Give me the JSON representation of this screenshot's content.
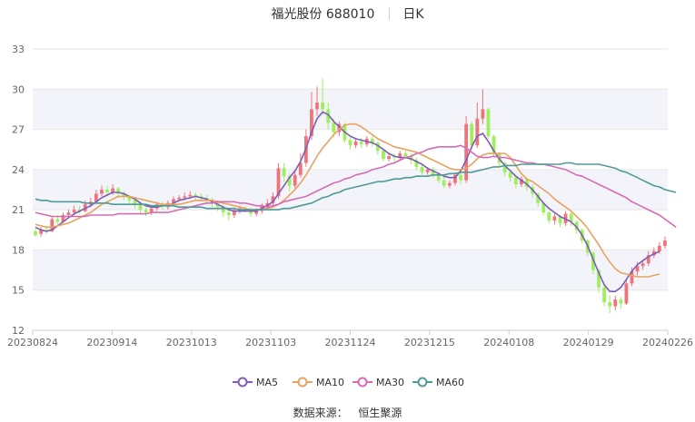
{
  "header": {
    "stock": "福光股份 688010",
    "period": "日K"
  },
  "source": {
    "label": "数据来源：",
    "value": "恒生聚源"
  },
  "colors": {
    "up": "#f0737a",
    "down": "#9cf05c",
    "ma5": "#7e5cb7",
    "ma10": "#e8a261",
    "ma30": "#d86bb4",
    "ma60": "#4f9a98"
  },
  "chart_data": {
    "type": "candlestick",
    "title": "福光股份 688010 日K",
    "ylim": [
      12,
      33
    ],
    "yticks": [
      12,
      15,
      18,
      21,
      24,
      27,
      30,
      33
    ],
    "xticks": [
      "20230824",
      "20230914",
      "20231013",
      "20231103",
      "20231124",
      "20231215",
      "20240108",
      "20240129",
      "20240226"
    ],
    "grid": "horizontal",
    "legend_position": "bottom",
    "legend": [
      "MA5",
      "MA10",
      "MA30",
      "MA60"
    ],
    "candles": [
      [
        19.4,
        19.1,
        19.6,
        19.0
      ],
      [
        19.2,
        19.5,
        19.7,
        19.0
      ],
      [
        19.5,
        19.4,
        19.8,
        19.2
      ],
      [
        19.4,
        20.3,
        20.5,
        19.3
      ],
      [
        20.3,
        20.1,
        20.6,
        19.9
      ],
      [
        20.1,
        20.6,
        20.8,
        20.0
      ],
      [
        20.6,
        20.8,
        21.0,
        20.4
      ],
      [
        20.8,
        21.0,
        21.3,
        20.6
      ],
      [
        21.0,
        20.9,
        21.3,
        20.7
      ],
      [
        20.9,
        21.4,
        21.7,
        20.8
      ],
      [
        21.4,
        21.6,
        21.9,
        21.2
      ],
      [
        21.6,
        22.2,
        22.5,
        21.4
      ],
      [
        22.2,
        22.5,
        22.8,
        22.0
      ],
      [
        22.5,
        22.3,
        22.8,
        22.0
      ],
      [
        22.3,
        22.6,
        22.9,
        22.1
      ],
      [
        22.6,
        22.2,
        22.7,
        21.9
      ],
      [
        22.2,
        22.0,
        22.4,
        21.7
      ],
      [
        22.0,
        21.7,
        22.1,
        21.4
      ],
      [
        21.7,
        21.4,
        21.9,
        21.1
      ],
      [
        21.4,
        21.0,
        21.6,
        20.7
      ],
      [
        21.0,
        20.8,
        21.2,
        20.5
      ],
      [
        20.8,
        21.1,
        21.3,
        20.6
      ],
      [
        21.1,
        21.4,
        21.6,
        20.9
      ],
      [
        21.4,
        21.2,
        21.6,
        21.0
      ],
      [
        21.2,
        21.5,
        21.7,
        21.0
      ],
      [
        21.5,
        21.8,
        22.0,
        21.3
      ],
      [
        21.8,
        21.9,
        22.1,
        21.6
      ],
      [
        21.9,
        22.0,
        22.3,
        21.7
      ],
      [
        22.0,
        22.1,
        22.4,
        21.8
      ],
      [
        22.1,
        22.0,
        22.3,
        21.7
      ],
      [
        22.0,
        21.9,
        22.2,
        21.6
      ],
      [
        21.9,
        21.7,
        22.1,
        21.5
      ],
      [
        21.7,
        21.5,
        21.9,
        21.2
      ],
      [
        21.5,
        21.2,
        21.7,
        20.9
      ],
      [
        21.2,
        20.8,
        21.4,
        20.5
      ],
      [
        20.8,
        20.6,
        21.0,
        20.2
      ],
      [
        20.6,
        20.9,
        21.1,
        20.4
      ],
      [
        20.9,
        21.1,
        21.3,
        20.7
      ],
      [
        21.1,
        21.0,
        21.3,
        20.8
      ],
      [
        21.0,
        20.7,
        21.2,
        20.5
      ],
      [
        20.7,
        20.9,
        21.1,
        20.5
      ],
      [
        20.9,
        21.3,
        21.5,
        20.7
      ],
      [
        21.3,
        21.5,
        21.8,
        21.1
      ],
      [
        21.5,
        22.0,
        22.3,
        21.3
      ],
      [
        22.0,
        24.1,
        24.5,
        21.8
      ],
      [
        24.1,
        23.5,
        24.5,
        23.1
      ],
      [
        23.5,
        22.8,
        23.7,
        22.4
      ],
      [
        22.8,
        23.6,
        24.0,
        22.6
      ],
      [
        23.6,
        24.5,
        25.2,
        23.4
      ],
      [
        24.5,
        26.5,
        27.0,
        24.2
      ],
      [
        26.5,
        28.5,
        29.8,
        26.2
      ],
      [
        28.5,
        29.0,
        30.2,
        28.0
      ],
      [
        29.0,
        28.5,
        30.8,
        28.1
      ],
      [
        28.5,
        27.5,
        29.0,
        27.0
      ],
      [
        27.5,
        26.8,
        27.8,
        26.4
      ],
      [
        26.8,
        27.4,
        27.6,
        26.5
      ],
      [
        27.4,
        26.2,
        27.5,
        26.0
      ],
      [
        26.2,
        25.8,
        26.4,
        25.5
      ],
      [
        25.8,
        26.1,
        26.3,
        25.6
      ],
      [
        26.1,
        25.9,
        26.4,
        25.6
      ],
      [
        25.9,
        26.3,
        26.5,
        25.7
      ],
      [
        26.3,
        26.0,
        26.5,
        25.7
      ],
      [
        26.0,
        25.4,
        26.1,
        25.1
      ],
      [
        25.4,
        24.8,
        25.6,
        24.6
      ],
      [
        24.8,
        25.0,
        25.2,
        24.6
      ],
      [
        25.0,
        24.9,
        25.2,
        24.6
      ],
      [
        24.9,
        25.2,
        25.4,
        24.7
      ],
      [
        25.2,
        25.0,
        25.4,
        24.8
      ],
      [
        25.0,
        24.7,
        25.2,
        24.4
      ],
      [
        24.7,
        24.2,
        24.9,
        24.0
      ],
      [
        24.2,
        23.8,
        24.4,
        23.6
      ],
      [
        23.8,
        24.0,
        24.2,
        23.6
      ],
      [
        24.0,
        23.6,
        24.2,
        23.4
      ],
      [
        23.6,
        23.2,
        23.8,
        23.0
      ],
      [
        23.2,
        22.8,
        23.5,
        22.6
      ],
      [
        22.8,
        23.0,
        23.2,
        22.6
      ],
      [
        23.0,
        23.6,
        23.8,
        22.8
      ],
      [
        23.6,
        23.2,
        23.8,
        22.9
      ],
      [
        23.2,
        27.4,
        28.0,
        23.0
      ],
      [
        27.4,
        25.8,
        27.6,
        25.5
      ],
      [
        25.8,
        27.8,
        29.0,
        25.6
      ],
      [
        27.8,
        28.5,
        30.0,
        27.4
      ],
      [
        28.5,
        26.5,
        28.6,
        26.3
      ],
      [
        26.5,
        25.2,
        26.6,
        25.0
      ],
      [
        25.2,
        24.5,
        25.3,
        24.2
      ],
      [
        24.5,
        23.8,
        24.6,
        23.5
      ],
      [
        23.8,
        23.4,
        24.0,
        23.1
      ],
      [
        23.4,
        22.9,
        23.6,
        22.6
      ],
      [
        22.9,
        23.3,
        23.5,
        22.7
      ],
      [
        23.3,
        22.7,
        23.4,
        22.4
      ],
      [
        22.7,
        22.2,
        22.9,
        21.9
      ],
      [
        22.2,
        21.5,
        22.3,
        21.2
      ],
      [
        21.5,
        20.8,
        21.6,
        20.6
      ],
      [
        20.8,
        20.2,
        20.9,
        20.0
      ],
      [
        20.2,
        20.5,
        20.7,
        19.9
      ],
      [
        20.5,
        20.0,
        20.6,
        19.7
      ],
      [
        20.0,
        20.7,
        20.9,
        19.8
      ],
      [
        20.7,
        20.1,
        20.8,
        19.8
      ],
      [
        20.1,
        19.5,
        20.2,
        19.2
      ],
      [
        19.5,
        18.7,
        19.6,
        18.5
      ],
      [
        18.7,
        17.8,
        18.8,
        17.5
      ],
      [
        17.8,
        16.5,
        17.9,
        16.2
      ],
      [
        16.5,
        15.2,
        16.6,
        14.8
      ],
      [
        15.2,
        14.1,
        15.3,
        13.8
      ],
      [
        14.1,
        13.8,
        14.6,
        13.3
      ],
      [
        13.8,
        14.3,
        14.6,
        13.5
      ],
      [
        14.3,
        14.0,
        14.5,
        13.6
      ],
      [
        14.0,
        15.5,
        15.8,
        13.9
      ],
      [
        15.5,
        16.4,
        16.7,
        15.3
      ],
      [
        16.4,
        16.8,
        17.1,
        16.1
      ],
      [
        16.8,
        17.0,
        17.3,
        16.5
      ],
      [
        17.0,
        17.6,
        17.9,
        16.8
      ],
      [
        17.6,
        17.9,
        18.2,
        17.4
      ],
      [
        17.9,
        18.3,
        18.6,
        17.7
      ],
      [
        18.3,
        18.7,
        19.0,
        18.1
      ]
    ],
    "series": [
      {
        "name": "MA5",
        "values": [
          19.7,
          19.5,
          19.4,
          19.5,
          19.8,
          20.1,
          20.4,
          20.7,
          20.9,
          21.1,
          21.3,
          21.6,
          21.9,
          22.1,
          22.3,
          22.3,
          22.2,
          22.0,
          21.8,
          21.5,
          21.3,
          21.2,
          21.2,
          21.3,
          21.3,
          21.5,
          21.7,
          21.8,
          21.9,
          22.0,
          21.9,
          21.8,
          21.6,
          21.4,
          21.2,
          21.0,
          20.9,
          20.9,
          20.9,
          20.9,
          20.9,
          21.1,
          21.3,
          21.6,
          22.2,
          22.8,
          23.4,
          23.9,
          24.6,
          25.6,
          26.8,
          27.8,
          28.3,
          28.1,
          27.6,
          27.2,
          26.8,
          26.5,
          26.3,
          26.2,
          26.1,
          26.0,
          25.8,
          25.5,
          25.2,
          25.0,
          24.9,
          24.9,
          24.8,
          24.6,
          24.4,
          24.1,
          23.9,
          23.7,
          23.5,
          23.4,
          23.4,
          23.9,
          24.7,
          25.7,
          26.5,
          26.7,
          26.1,
          25.4,
          24.8,
          24.3,
          23.9,
          23.5,
          23.2,
          22.9,
          22.5,
          22.0,
          21.5,
          21.1,
          20.8,
          20.5,
          20.3,
          20.1,
          19.7,
          19.1,
          18.3,
          17.3,
          16.3,
          15.4,
          14.9,
          14.9,
          15.2,
          15.8,
          16.4,
          16.9,
          17.2,
          17.5,
          17.7,
          17.9
        ]
      },
      {
        "name": "MA10",
        "values": [
          19.9,
          19.8,
          19.7,
          19.7,
          19.8,
          19.9,
          20.0,
          20.2,
          20.4,
          20.6,
          20.8,
          21.1,
          21.4,
          21.6,
          21.8,
          22.0,
          22.0,
          22.0,
          21.9,
          21.8,
          21.7,
          21.6,
          21.5,
          21.4,
          21.4,
          21.4,
          21.4,
          21.5,
          21.6,
          21.7,
          21.7,
          21.7,
          21.7,
          21.6,
          21.5,
          21.4,
          21.3,
          21.2,
          21.1,
          21.0,
          21.0,
          21.0,
          21.1,
          21.2,
          21.4,
          21.7,
          22.1,
          22.5,
          23.0,
          23.6,
          24.3,
          25.0,
          25.6,
          26.1,
          26.6,
          27.0,
          27.3,
          27.4,
          27.4,
          27.2,
          26.9,
          26.6,
          26.3,
          26.1,
          25.9,
          25.7,
          25.6,
          25.5,
          25.4,
          25.3,
          25.1,
          24.9,
          24.7,
          24.5,
          24.3,
          24.1,
          24.0,
          24.0,
          24.1,
          24.4,
          24.8,
          25.1,
          25.2,
          25.2,
          25.2,
          25.2,
          24.9,
          24.3,
          23.7,
          23.3,
          23.1,
          22.8,
          22.5,
          22.2,
          21.8,
          21.5,
          21.2,
          20.9,
          20.5,
          20.1,
          19.6,
          19.0,
          18.4,
          17.7,
          17.1,
          16.6,
          16.3,
          16.2,
          16.1,
          16.0,
          16.0,
          16.0,
          16.1,
          16.2
        ]
      },
      {
        "name": "MA30",
        "values": [
          20.8,
          20.7,
          20.6,
          20.5,
          20.5,
          20.5,
          20.5,
          20.5,
          20.5,
          20.5,
          20.6,
          20.6,
          20.6,
          20.6,
          20.6,
          20.7,
          20.7,
          20.7,
          20.7,
          20.7,
          20.7,
          20.8,
          20.8,
          20.8,
          20.8,
          20.9,
          21.0,
          21.1,
          21.2,
          21.3,
          21.4,
          21.5,
          21.5,
          21.6,
          21.6,
          21.6,
          21.6,
          21.5,
          21.5,
          21.4,
          21.3,
          21.3,
          21.2,
          21.3,
          21.4,
          21.6,
          21.7,
          21.8,
          21.9,
          22.0,
          22.2,
          22.4,
          22.6,
          22.8,
          23.0,
          23.1,
          23.3,
          23.4,
          23.6,
          23.7,
          23.8,
          24.0,
          24.1,
          24.2,
          24.4,
          24.5,
          24.7,
          24.9,
          25.0,
          25.2,
          25.3,
          25.5,
          25.6,
          25.7,
          25.7,
          25.7,
          25.7,
          25.8,
          25.6,
          25.3,
          25.0,
          24.9,
          24.9,
          25.0,
          24.9,
          24.9,
          24.8,
          24.7,
          24.6,
          24.5,
          24.5,
          24.4,
          24.4,
          24.3,
          24.2,
          24.1,
          24.0,
          23.8,
          23.6,
          23.5,
          23.3,
          23.1,
          22.9,
          22.7,
          22.5,
          22.3,
          22.1,
          21.9,
          21.6,
          21.4,
          21.2,
          21.0,
          20.8,
          20.6,
          20.3,
          20.0,
          19.7
        ]
      },
      {
        "name": "MA60",
        "values": [
          21.8,
          21.7,
          21.7,
          21.6,
          21.6,
          21.6,
          21.6,
          21.6,
          21.6,
          21.5,
          21.5,
          21.5,
          21.5,
          21.5,
          21.4,
          21.4,
          21.4,
          21.4,
          21.4,
          21.4,
          21.4,
          21.3,
          21.3,
          21.3,
          21.3,
          21.3,
          21.2,
          21.2,
          21.2,
          21.2,
          21.2,
          21.1,
          21.1,
          21.1,
          21.1,
          21.1,
          21.1,
          21.0,
          21.0,
          21.0,
          21.0,
          21.0,
          21.0,
          21.0,
          21.0,
          21.1,
          21.1,
          21.2,
          21.3,
          21.4,
          21.5,
          21.7,
          21.9,
          22.0,
          22.2,
          22.3,
          22.5,
          22.6,
          22.7,
          22.8,
          22.9,
          23.0,
          23.1,
          23.1,
          23.2,
          23.3,
          23.3,
          23.4,
          23.4,
          23.5,
          23.5,
          23.5,
          23.6,
          23.6,
          23.6,
          23.7,
          23.7,
          23.8,
          23.8,
          23.8,
          23.9,
          24.0,
          24.1,
          24.2,
          24.2,
          24.3,
          24.3,
          24.3,
          24.4,
          24.4,
          24.4,
          24.4,
          24.4,
          24.4,
          24.4,
          24.4,
          24.5,
          24.5,
          24.4,
          24.4,
          24.4,
          24.4,
          24.4,
          24.3,
          24.2,
          24.1,
          23.9,
          23.8,
          23.6,
          23.4,
          23.2,
          23.0,
          22.8,
          22.7,
          22.5,
          22.4,
          22.3
        ]
      }
    ]
  }
}
